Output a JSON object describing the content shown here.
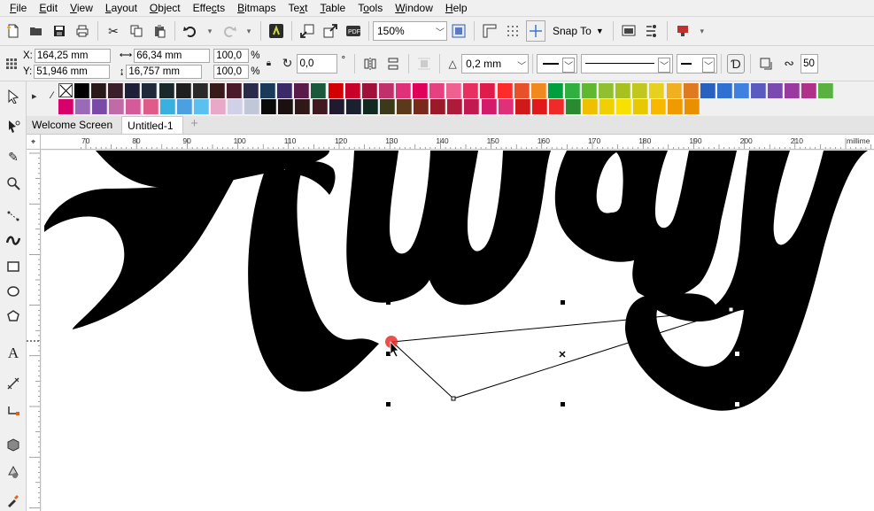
{
  "menu": [
    {
      "pre": "",
      "u": "F",
      "post": "ile"
    },
    {
      "pre": "",
      "u": "E",
      "post": "dit"
    },
    {
      "pre": "",
      "u": "V",
      "post": "iew"
    },
    {
      "pre": "",
      "u": "L",
      "post": "ayout"
    },
    {
      "pre": "",
      "u": "O",
      "post": "bject"
    },
    {
      "pre": "Effe",
      "u": "c",
      "post": "ts"
    },
    {
      "pre": "",
      "u": "B",
      "post": "itmaps"
    },
    {
      "pre": "Te",
      "u": "x",
      "post": "t"
    },
    {
      "pre": "",
      "u": "T",
      "post": "able"
    },
    {
      "pre": "T",
      "u": "o",
      "post": "ols"
    },
    {
      "pre": "",
      "u": "W",
      "post": "indow"
    },
    {
      "pre": "",
      "u": "H",
      "post": "elp"
    }
  ],
  "toolbar": {
    "zoom": "150%",
    "snap_label": "Snap To"
  },
  "propbar": {
    "x_label": "X:",
    "x_value": "164,25 mm",
    "y_label": "Y:",
    "y_value": "51,946 mm",
    "width_value": "66,34 mm",
    "height_value": "16,757 mm",
    "scale_x": "100,0",
    "scale_y": "100,0",
    "pct": "%",
    "angle": "0,0",
    "degree": "°",
    "outline_width": "0,2 mm",
    "smooth_value": "50"
  },
  "tabs": {
    "welcome": "Welcome Screen",
    "doc": "Untitled-1",
    "add": "+"
  },
  "ruler": {
    "ticks": [
      "70",
      "80",
      "90",
      "100",
      "110",
      "120",
      "130",
      "140",
      "150",
      "160",
      "170",
      "180",
      "190",
      "200",
      "210"
    ],
    "unit": "millime"
  },
  "palette": {
    "row1": [
      "#000000",
      "#2b1a1a",
      "#3a1f2b",
      "#1f1f3a",
      "#202a3a",
      "#1a2a2a",
      "#1f1f1f",
      "#2a2a2a",
      "#3a1a1a",
      "#4a1a2a",
      "#2a2a4a",
      "#1a3a5a",
      "#3a2a6a",
      "#5a1a4a",
      "#1a5a3a",
      "#d40000",
      "#c8002a",
      "#a0103a",
      "#c0306a",
      "#e0307a",
      "#e0005a",
      "#e64080",
      "#f06090",
      "#e83060",
      "#e01a4a",
      "#ff2a2a",
      "#e8502a",
      "#f08a20",
      "#00a040",
      "#30b040",
      "#60b830",
      "#90c030",
      "#a8c020",
      "#c0c820",
      "#e8d020",
      "#f0b020",
      "#e07a20",
      "#2a60c0",
      "#3070d0",
      "#4080e0",
      "#5a5ac0",
      "#7a4ab0",
      "#9a3aa0",
      "#b0308a",
      "#5ab040"
    ],
    "row2": [
      "#d8006a",
      "#9a6ab8",
      "#7a4aa8",
      "#c06aa8",
      "#d45a9a",
      "#e05a8a",
      "#3ab0e0",
      "#4aa0e0",
      "#5ac0f0",
      "#e8a8c8",
      "#d0d0e8",
      "#c0c8d8",
      "#0a0a0a",
      "#1a1010",
      "#301818",
      "#401a20",
      "#201a30",
      "#1a2030",
      "#102a20",
      "#3a3a1a",
      "#5a3a1a",
      "#7a2a1a",
      "#9a1a2a",
      "#b01a3a",
      "#c01a50",
      "#d41a6a",
      "#e0307a",
      "#d01a1a",
      "#e01a1a",
      "#f02a2a",
      "#2a8a30",
      "#f0c000",
      "#f0d000",
      "#f8e000",
      "#e8c800",
      "#f8b800",
      "#f09a00",
      "#e89000"
    ]
  },
  "colors": {
    "selection_red": "#e8302a",
    "artwork": "#000000",
    "ui_bg": "#f0f0f0"
  }
}
